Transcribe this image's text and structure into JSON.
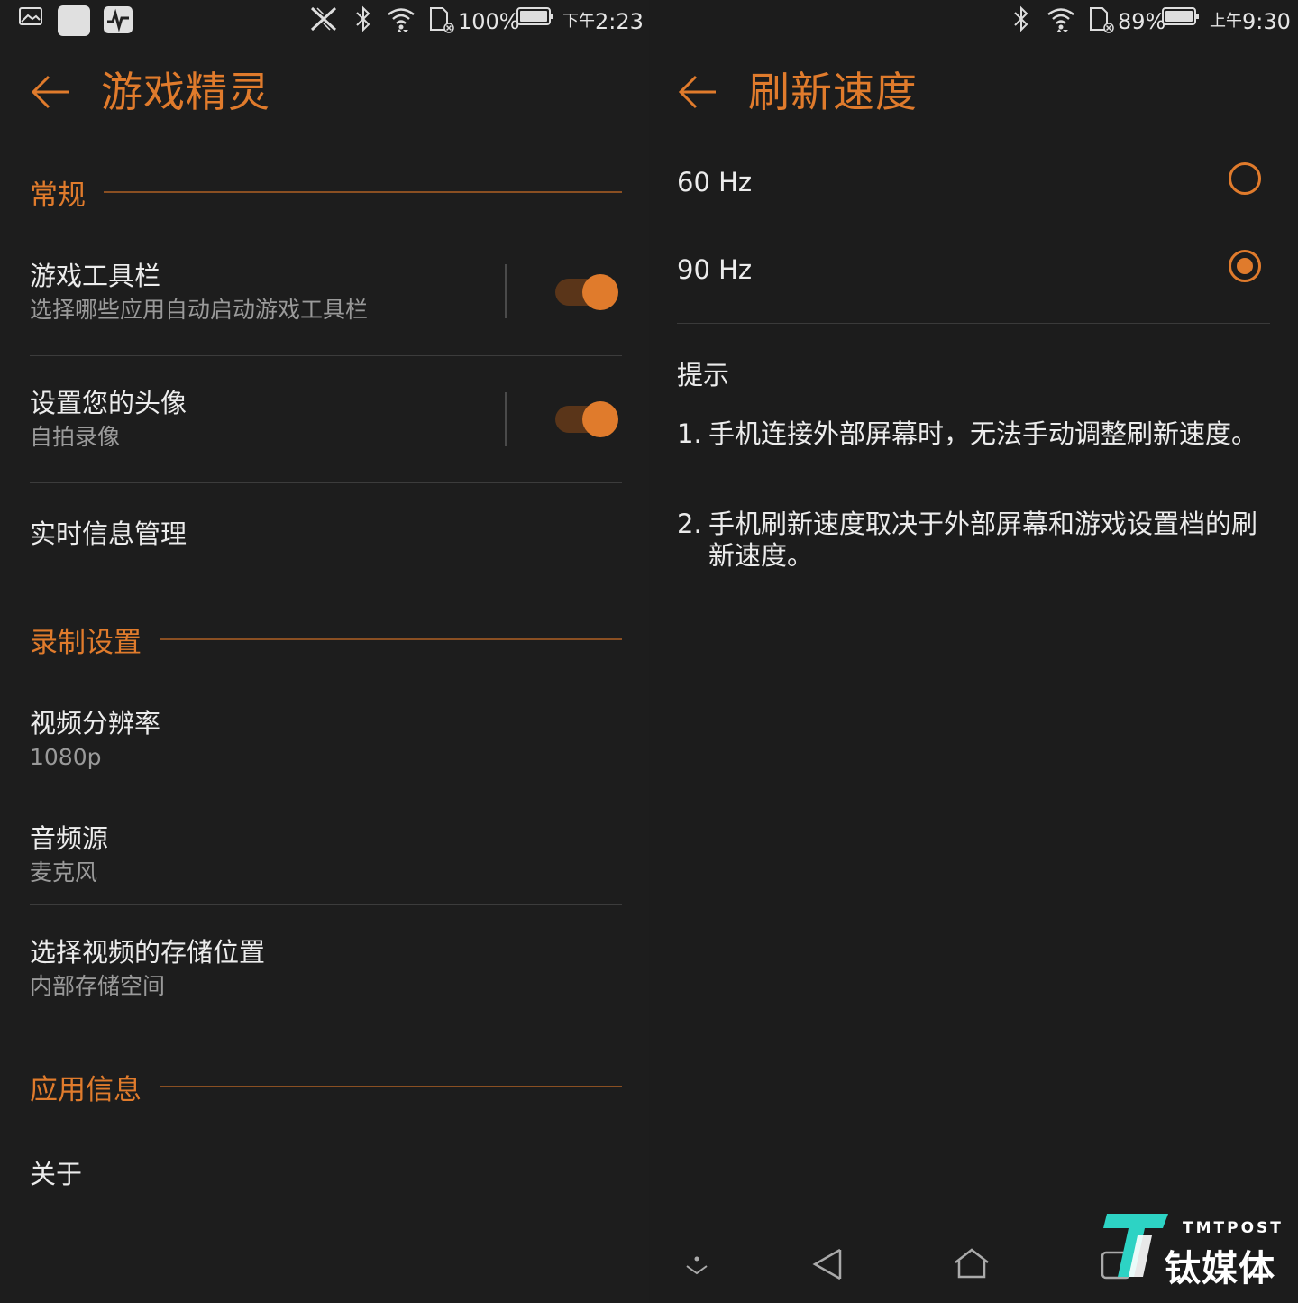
{
  "left": {
    "status": {
      "battery_percent": "100%",
      "time_prefix": "下午",
      "time": "2:23"
    },
    "title": "游戏精灵",
    "sections": {
      "general": "常规",
      "record": "录制设置",
      "appinfo": "应用信息"
    },
    "items": {
      "toolbar": {
        "title": "游戏工具栏",
        "subtitle": "选择哪些应用自动启动游戏工具栏",
        "enabled": true
      },
      "avatar": {
        "title": "设置您的头像",
        "subtitle": "自拍录像",
        "enabled": true
      },
      "realtime": {
        "title": "实时信息管理"
      },
      "resolution": {
        "title": "视频分辨率",
        "subtitle": "1080p"
      },
      "audio": {
        "title": "音频源",
        "subtitle": "麦克风"
      },
      "storage": {
        "title": "选择视频的存储位置",
        "subtitle": "内部存储空间"
      },
      "about": {
        "title": "关于"
      }
    }
  },
  "right": {
    "status": {
      "battery_percent": "89%",
      "time_prefix": "上午",
      "time": "9:30"
    },
    "title": "刷新速度",
    "options": [
      {
        "label": "60 Hz",
        "selected": false
      },
      {
        "label": "90 Hz",
        "selected": true
      }
    ],
    "hint_title": "提示",
    "hints": [
      {
        "num": "1.",
        "text": "手机连接外部屏幕时，无法手动调整刷新速度。"
      },
      {
        "num": "2.",
        "text": "手机刷新速度取决于外部屏幕和游戏设置档的刷新速度。"
      }
    ]
  },
  "watermark": {
    "en": "TMTPOST",
    "cn": "钛媒体"
  },
  "colors": {
    "accent": "#e07b2c",
    "background": "#1d1d1d",
    "divider": "#3c3c3c"
  }
}
